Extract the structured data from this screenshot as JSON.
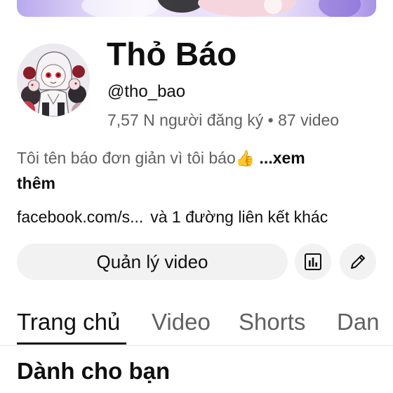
{
  "channel": {
    "name": "Thỏ Báo",
    "handle": "@tho_bao",
    "stats": "7,57 N người đăng ký • 87 video",
    "description": "Tôi tên báo đơn giản vì tôi báo",
    "description_emoji": "👍",
    "more_label": "...xem",
    "more_label_2": "thêm",
    "link": "facebook.com/s...",
    "extra_links": "và 1 đường liên kết khác"
  },
  "actions": {
    "manage_label": "Quản lý video",
    "analytics_icon": "analytics-icon",
    "edit_icon": "pencil-icon"
  },
  "tabs": [
    {
      "label": "Trang chủ",
      "active": true
    },
    {
      "label": "Video",
      "active": false
    },
    {
      "label": "Shorts",
      "active": false
    },
    {
      "label": "Dan",
      "active": false
    }
  ],
  "section": {
    "title": "Dành cho bạn"
  },
  "colors": {
    "text_primary": "#0f0f0f",
    "text_secondary": "#606060",
    "button_bg": "#f2f2f2",
    "banner_accent": "#b9a8ec"
  }
}
